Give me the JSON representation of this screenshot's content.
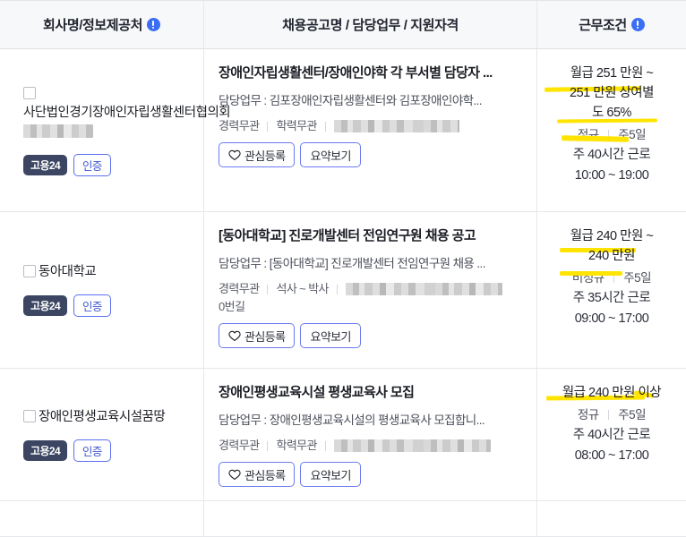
{
  "header": {
    "columns": [
      {
        "label": "회사명/정보제공처",
        "has_info_icon": true,
        "icon": "info-icon"
      },
      {
        "label": "채용공고명 / 담당업무 / 지원자격",
        "has_info_icon": false,
        "icon": ""
      },
      {
        "label": "근무조건",
        "has_info_icon": true,
        "icon": "info-icon"
      }
    ]
  },
  "labels": {
    "duty_prefix": "담당업무 : ",
    "interest_button": "관심등록",
    "summary_button": "요약보기",
    "heart_icon": "heart-icon",
    "checkbox": "row-checkbox"
  },
  "colors": {
    "accent_blue": "#3b6ef5",
    "badge_navy": "#3c4663",
    "badge_border_blue": "#5a6ff0",
    "marker_yellow": "#ffe400",
    "header_bg": "#f7f8f9",
    "border": "#e6e8ec"
  },
  "rows": [
    {
      "company": {
        "name": "사단법인경기장애인자립생활센터협의회",
        "name_blurred": true,
        "badge_source": "고용24",
        "badge_verified": "인증"
      },
      "posting": {
        "title": "장애인자립생활센터/장애인야학 각 부서별 담당자 ...",
        "duty": "담당업무 : 김포장애인자립생활센터와 김포장애인야학...",
        "tag_career": "경력무관",
        "tag_education": "학력무관",
        "tag_location_blurred": true,
        "tag_location_extra": ""
      },
      "condition": {
        "salary_line1": "월급 251 만원 ~",
        "salary_line2": "251 만원 상여별",
        "salary_line3": "도 65%",
        "employment_type": "정규",
        "work_days": "주5일",
        "work_hours": "주 40시간 근로",
        "work_time": "10:00 ~ 19:00"
      }
    },
    {
      "company": {
        "name": "동아대학교",
        "name_blurred": false,
        "badge_source": "고용24",
        "badge_verified": "인증"
      },
      "posting": {
        "title": "[동아대학교] 진로개발센터 전임연구원 채용 공고",
        "duty": "담당업무 : [동아대학교] 진로개발센터 전임연구원 채용 ...",
        "tag_career": "경력무관",
        "tag_education": "석사 ~ 박사",
        "tag_location_blurred": true,
        "tag_location_extra": "0번길"
      },
      "condition": {
        "salary_line1": "월급 240 만원 ~",
        "salary_line2": "240 만원",
        "salary_line3": "",
        "employment_type": "비정규",
        "work_days": "주5일",
        "work_hours": "주 35시간 근로",
        "work_time": "09:00 ~ 17:00"
      }
    },
    {
      "company": {
        "name": "장애인평생교육시설꿈땅",
        "name_blurred": false,
        "badge_source": "고용24",
        "badge_verified": "인증"
      },
      "posting": {
        "title": "장애인평생교육시설 평생교육사 모집",
        "duty": "담당업무 : 장애인평생교육시설의 평생교육사 모집합니...",
        "tag_career": "경력무관",
        "tag_education": "학력무관",
        "tag_location_blurred": true,
        "tag_location_extra": ""
      },
      "condition": {
        "salary_line1": "월급 240 만원 이상",
        "salary_line2": "",
        "salary_line3": "",
        "employment_type": "정규",
        "work_days": "주5일",
        "work_hours": "주 40시간 근로",
        "work_time": "08:00 ~ 17:00"
      }
    }
  ]
}
